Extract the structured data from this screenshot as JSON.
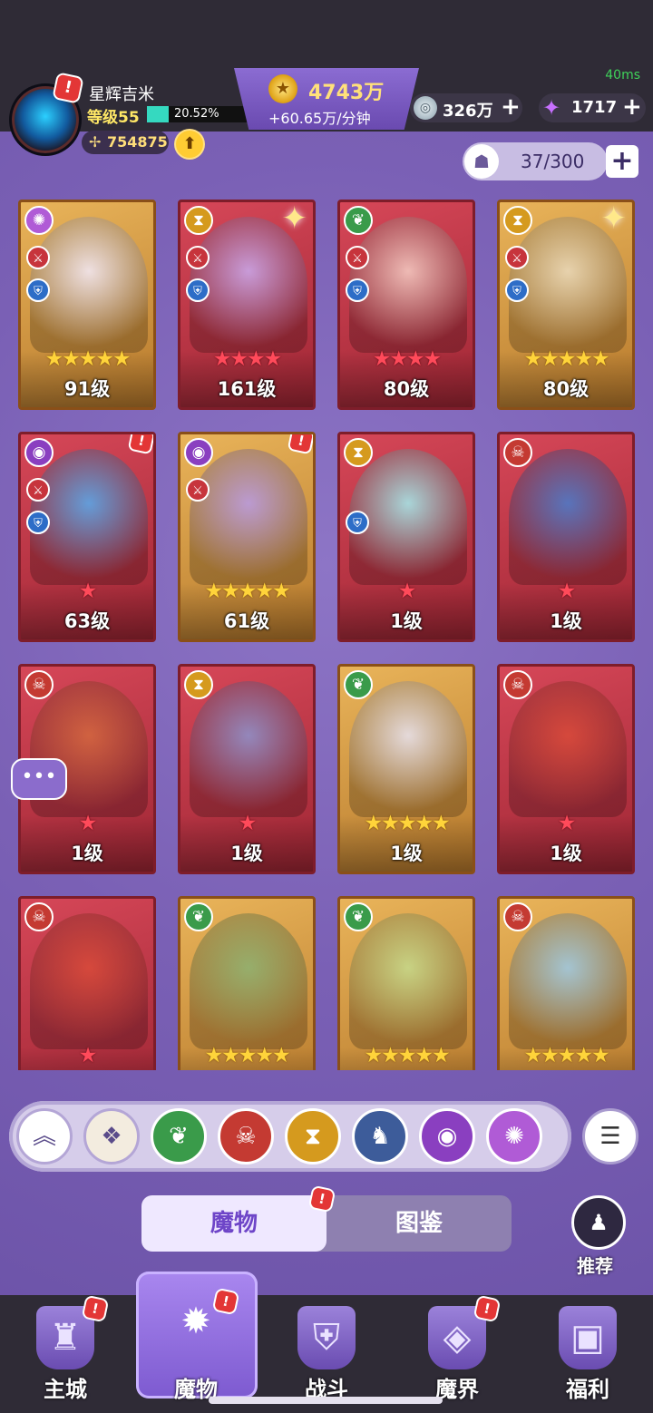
{
  "status": {
    "fps": "40ms"
  },
  "player": {
    "name": "星辉吉米",
    "level": "等级55",
    "xp_percent_text": "20.52%",
    "xp_fraction": 0.2052,
    "power": "754875",
    "avatar_alert": "!",
    "upgrade_icon": "arrow-up-icon"
  },
  "currency": {
    "gold": "4743万",
    "gold_rate": "+60.65万/分钟",
    "silver": "326万",
    "silver_plus": "+",
    "crystal": "1717",
    "crystal_plus": "+"
  },
  "collection": {
    "count": "37/300",
    "plus": "+"
  },
  "cards": [
    {
      "level": "91级",
      "stars": 5,
      "star_color": "gold",
      "frame": "gold",
      "element": "vortex",
      "elem_color": "#b05bd6",
      "atk": true,
      "def": true
    },
    {
      "level": "161级",
      "stars": 4,
      "star_color": "red",
      "frame": "red",
      "element": "hourglass",
      "elem_color": "#d59a1e",
      "atk": true,
      "def": true,
      "sparkle": true
    },
    {
      "level": "80级",
      "stars": 4,
      "star_color": "red",
      "frame": "red",
      "element": "leaf",
      "elem_color": "#3a9b4a",
      "atk": true,
      "def": true
    },
    {
      "level": "80级",
      "stars": 5,
      "star_color": "gold",
      "frame": "gold",
      "element": "hourglass",
      "elem_color": "#d59a1e",
      "atk": true,
      "def": true,
      "sparkle": true
    },
    {
      "level": "63级",
      "stars": 1,
      "star_color": "red",
      "frame": "red",
      "element": "eye",
      "elem_color": "#8a3fc0",
      "atk": true,
      "def": true,
      "alert": true
    },
    {
      "level": "61级",
      "stars": 5,
      "star_color": "gold",
      "frame": "gold",
      "element": "eye",
      "elem_color": "#8a3fc0",
      "atk": true,
      "alert": true
    },
    {
      "level": "1级",
      "stars": 1,
      "star_color": "red",
      "frame": "red",
      "element": "hourglass",
      "elem_color": "#d59a1e",
      "def": true
    },
    {
      "level": "1级",
      "stars": 1,
      "star_color": "red",
      "frame": "red",
      "element": "skull",
      "elem_color": "#c43a32"
    },
    {
      "level": "1级",
      "stars": 1,
      "star_color": "red",
      "frame": "red",
      "element": "skull",
      "elem_color": "#c43a32"
    },
    {
      "level": "1级",
      "stars": 1,
      "star_color": "red",
      "frame": "red",
      "element": "hourglass",
      "elem_color": "#d59a1e"
    },
    {
      "level": "1级",
      "stars": 5,
      "star_color": "gold",
      "frame": "gold",
      "element": "leaf",
      "elem_color": "#3a9b4a"
    },
    {
      "level": "1级",
      "stars": 1,
      "star_color": "red",
      "frame": "red",
      "element": "skull",
      "elem_color": "#c43a32"
    },
    {
      "level": "",
      "stars": 1,
      "star_color": "red",
      "frame": "red",
      "element": "skull",
      "elem_color": "#c43a32"
    },
    {
      "level": "",
      "stars": 5,
      "star_color": "gold",
      "frame": "gold",
      "element": "leaf",
      "elem_color": "#3a9b4a"
    },
    {
      "level": "",
      "stars": 5,
      "star_color": "gold",
      "frame": "gold",
      "element": "leaf",
      "elem_color": "#3a9b4a"
    },
    {
      "level": "",
      "stars": 5,
      "star_color": "gold",
      "frame": "gold",
      "element": "skull",
      "elem_color": "#c43a32"
    }
  ],
  "filters": [
    {
      "name": "collapse",
      "icon": "chevron-up-icon",
      "color": "#ffffff"
    },
    {
      "name": "all",
      "icon": "diamond-grid-icon",
      "color": "#f3ecdf"
    },
    {
      "name": "leaf",
      "icon": "leaf-icon",
      "color": "#3a9b4a"
    },
    {
      "name": "skull",
      "icon": "skull-icon",
      "color": "#c43a32"
    },
    {
      "name": "hourglass",
      "icon": "hourglass-icon",
      "color": "#d59a1e"
    },
    {
      "name": "dragon",
      "icon": "dragon-icon",
      "color": "#3d5c9a"
    },
    {
      "name": "eye",
      "icon": "eye-icon",
      "color": "#8a3fc0"
    },
    {
      "name": "vortex",
      "icon": "vortex-icon",
      "color": "#b05bd6"
    }
  ],
  "tabs": {
    "active": "魔物",
    "inactive": "图鉴",
    "tab_alert": "!"
  },
  "recommend": {
    "label": "推荐"
  },
  "nav": [
    {
      "label": "主城",
      "icon": "castle-icon",
      "alert": true
    },
    {
      "label": "魔物",
      "icon": "flame-star-icon",
      "alert": true,
      "active": true
    },
    {
      "label": "战斗",
      "icon": "sword-shield-icon"
    },
    {
      "label": "魔界",
      "icon": "portal-icon",
      "alert": true
    },
    {
      "label": "福利",
      "icon": "chest-icon"
    }
  ],
  "colors": {
    "accent": "#7a60b5",
    "topbar": "#2f2b36",
    "gold_text": "#ffe07a"
  }
}
